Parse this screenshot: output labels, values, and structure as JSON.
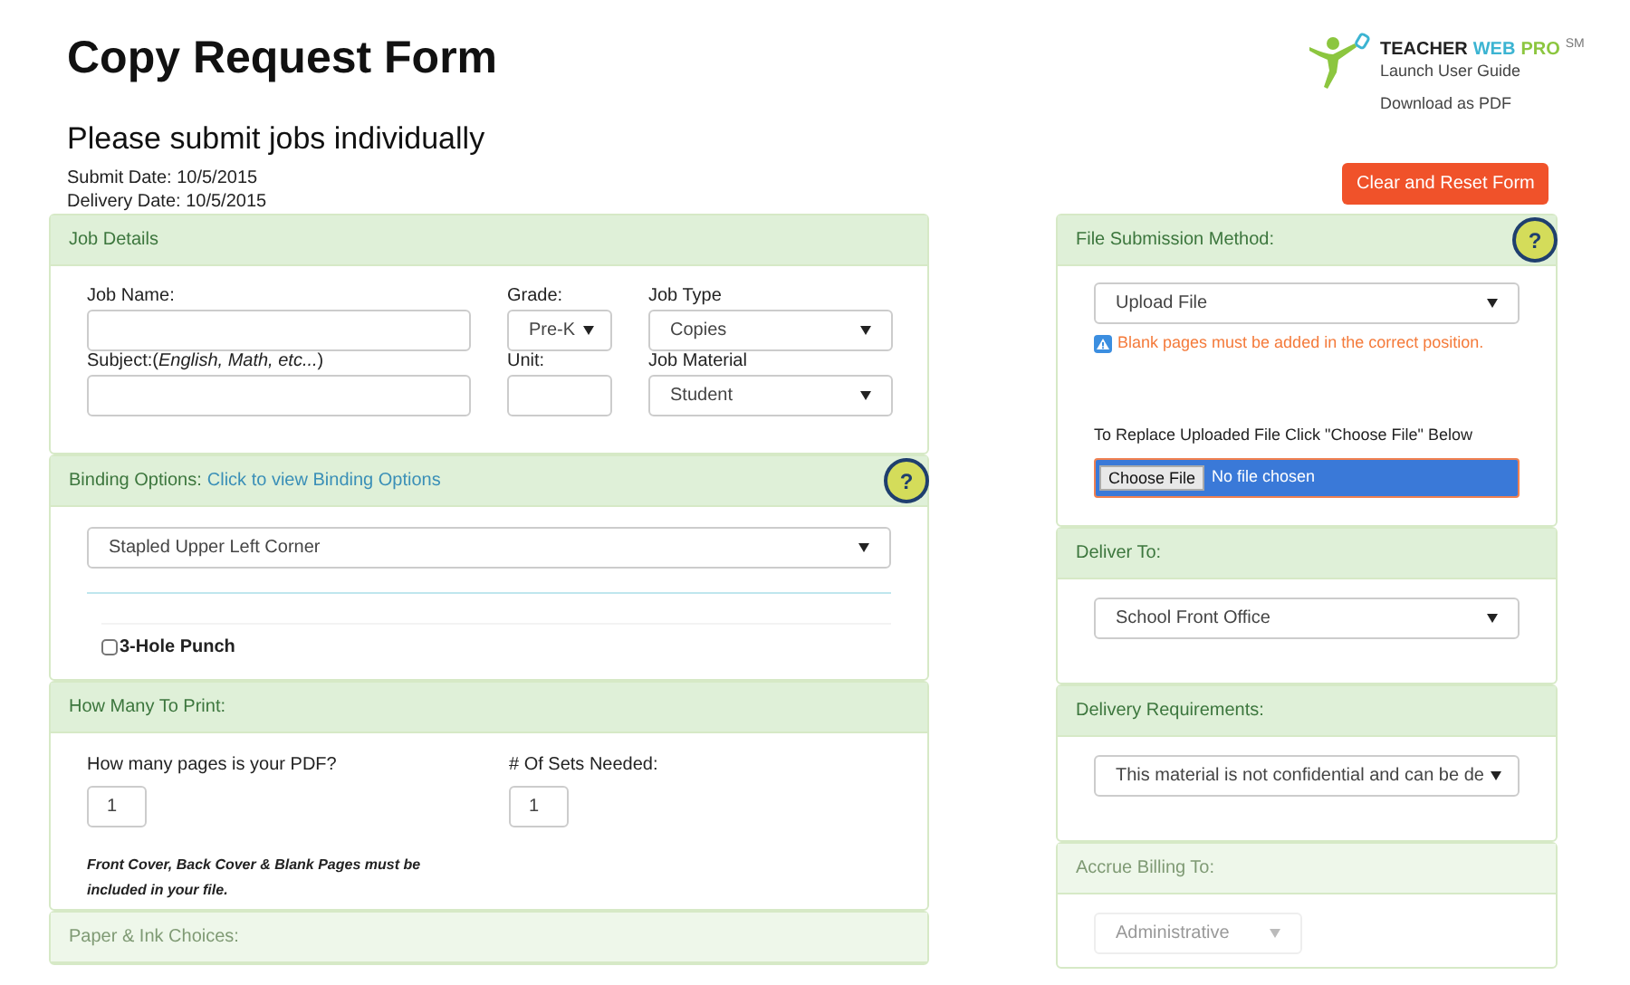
{
  "header": {
    "title": "Copy Request Form",
    "subtitle": "Please submit jobs individually",
    "dates": [
      "Submit Date: 10/5/2015",
      "Delivery Date: 10/5/2015"
    ]
  },
  "logo": {
    "words": [
      {
        "text": "TEACHER",
        "color": "#222222"
      },
      {
        "text": "WEB",
        "color": "#3cb4d2"
      },
      {
        "text": "PRO",
        "color": "#8cc63f"
      }
    ],
    "mark": "SM",
    "links": [
      "Launch User Guide",
      "Download as PDF"
    ]
  },
  "reset_button": "Clear and Reset Form",
  "left_panels": [
    {
      "kind": "job_details",
      "title": "Job Details",
      "faded": false,
      "fields": [
        {
          "kind": "text",
          "label": "Job Name:"
        },
        {
          "kind": "select",
          "label": "Grade:",
          "value": "Pre-K"
        },
        {
          "kind": "select",
          "label": "Job Type",
          "value": "Copies"
        },
        {
          "kind": "text",
          "label": "Subject:(*English, Math, etc...*)"
        },
        {
          "kind": "text",
          "label": "Unit:"
        },
        {
          "kind": "select",
          "label": "Job Material",
          "value": "Student"
        }
      ]
    },
    {
      "kind": "binding",
      "title": "Binding Options:",
      "link": "Click to view Binding Options",
      "help": "?",
      "faded": false,
      "select": "Stapled Upper Left Corner",
      "checkbox": {
        "label": "3-Hole Punch",
        "checked": false
      }
    },
    {
      "kind": "print_count",
      "title": "How Many To Print:",
      "faded": false,
      "fields": [
        {
          "label": "How many pages is your PDF?",
          "value": "1"
        },
        {
          "label": "# Of Sets Needed:",
          "value": "1"
        }
      ],
      "note": "Front Cover, Back Cover & Blank Pages must be included in your file."
    },
    {
      "kind": "header_only",
      "title": "Paper & Ink Choices:",
      "faded": true
    }
  ],
  "right_panels": [
    {
      "kind": "file_submission",
      "title": "File Submission Method:",
      "help": "?",
      "faded": false,
      "select": "Upload File",
      "warning": "Blank pages must be added in the correct position.",
      "replace_label": "To Replace Uploaded File Click \"Choose File\" Below",
      "file_button": "Choose File",
      "file_status": "No file chosen"
    },
    {
      "kind": "select_only",
      "title": "Deliver To:",
      "faded": false,
      "select": "School Front Office"
    },
    {
      "kind": "select_only",
      "title": "Delivery Requirements:",
      "faded": false,
      "select": "This material is not confidential and can be de"
    },
    {
      "kind": "billing",
      "title": "Accrue Billing To:",
      "faded": true,
      "select": "Administrative"
    }
  ]
}
